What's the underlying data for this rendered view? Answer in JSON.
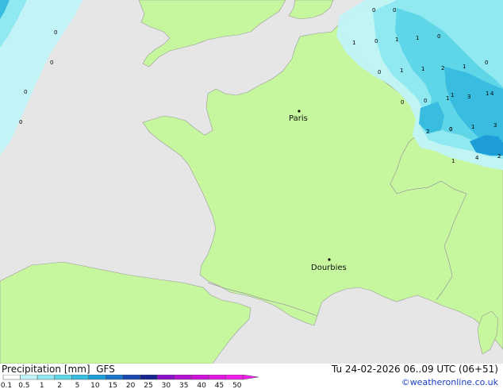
{
  "title": {
    "parameter": "Precipitation [mm]",
    "model": "GFS"
  },
  "valid_time": "Tu 24-02-2026 06..09 UTC (06+51)",
  "credit": "©weatheronline.co.uk",
  "cities": [
    {
      "name": "Paris"
    },
    {
      "name": "Dourbies"
    }
  ],
  "precip_labels": [
    "0",
    "0",
    "0",
    "0",
    "0",
    "0",
    "0",
    "1",
    "0",
    "1",
    "1",
    "0",
    "1",
    "1",
    "0",
    "0",
    "1",
    "1",
    "2",
    "1",
    "0",
    "1",
    "3",
    "4",
    "0",
    "2",
    "0",
    "1",
    "3",
    "4",
    "2",
    "1"
  ],
  "legend": {
    "ticks": [
      "0.1",
      "0.5",
      "1",
      "2",
      "5",
      "10",
      "15",
      "20",
      "25",
      "30",
      "35",
      "40",
      "45",
      "50"
    ],
    "colors": [
      "#ffffff",
      "#c0f4f8",
      "#90e8f0",
      "#5ed6e8",
      "#38bde0",
      "#1e9ed8",
      "#1a74c8",
      "#1848b0",
      "#16268e",
      "#8a10c8",
      "#b012d0",
      "#cc14d8",
      "#e018e0",
      "#f020e8"
    ]
  },
  "colors": {
    "land": "#c6f79e",
    "sea": "#e6e6e6",
    "border": "#9a9a9a"
  }
}
